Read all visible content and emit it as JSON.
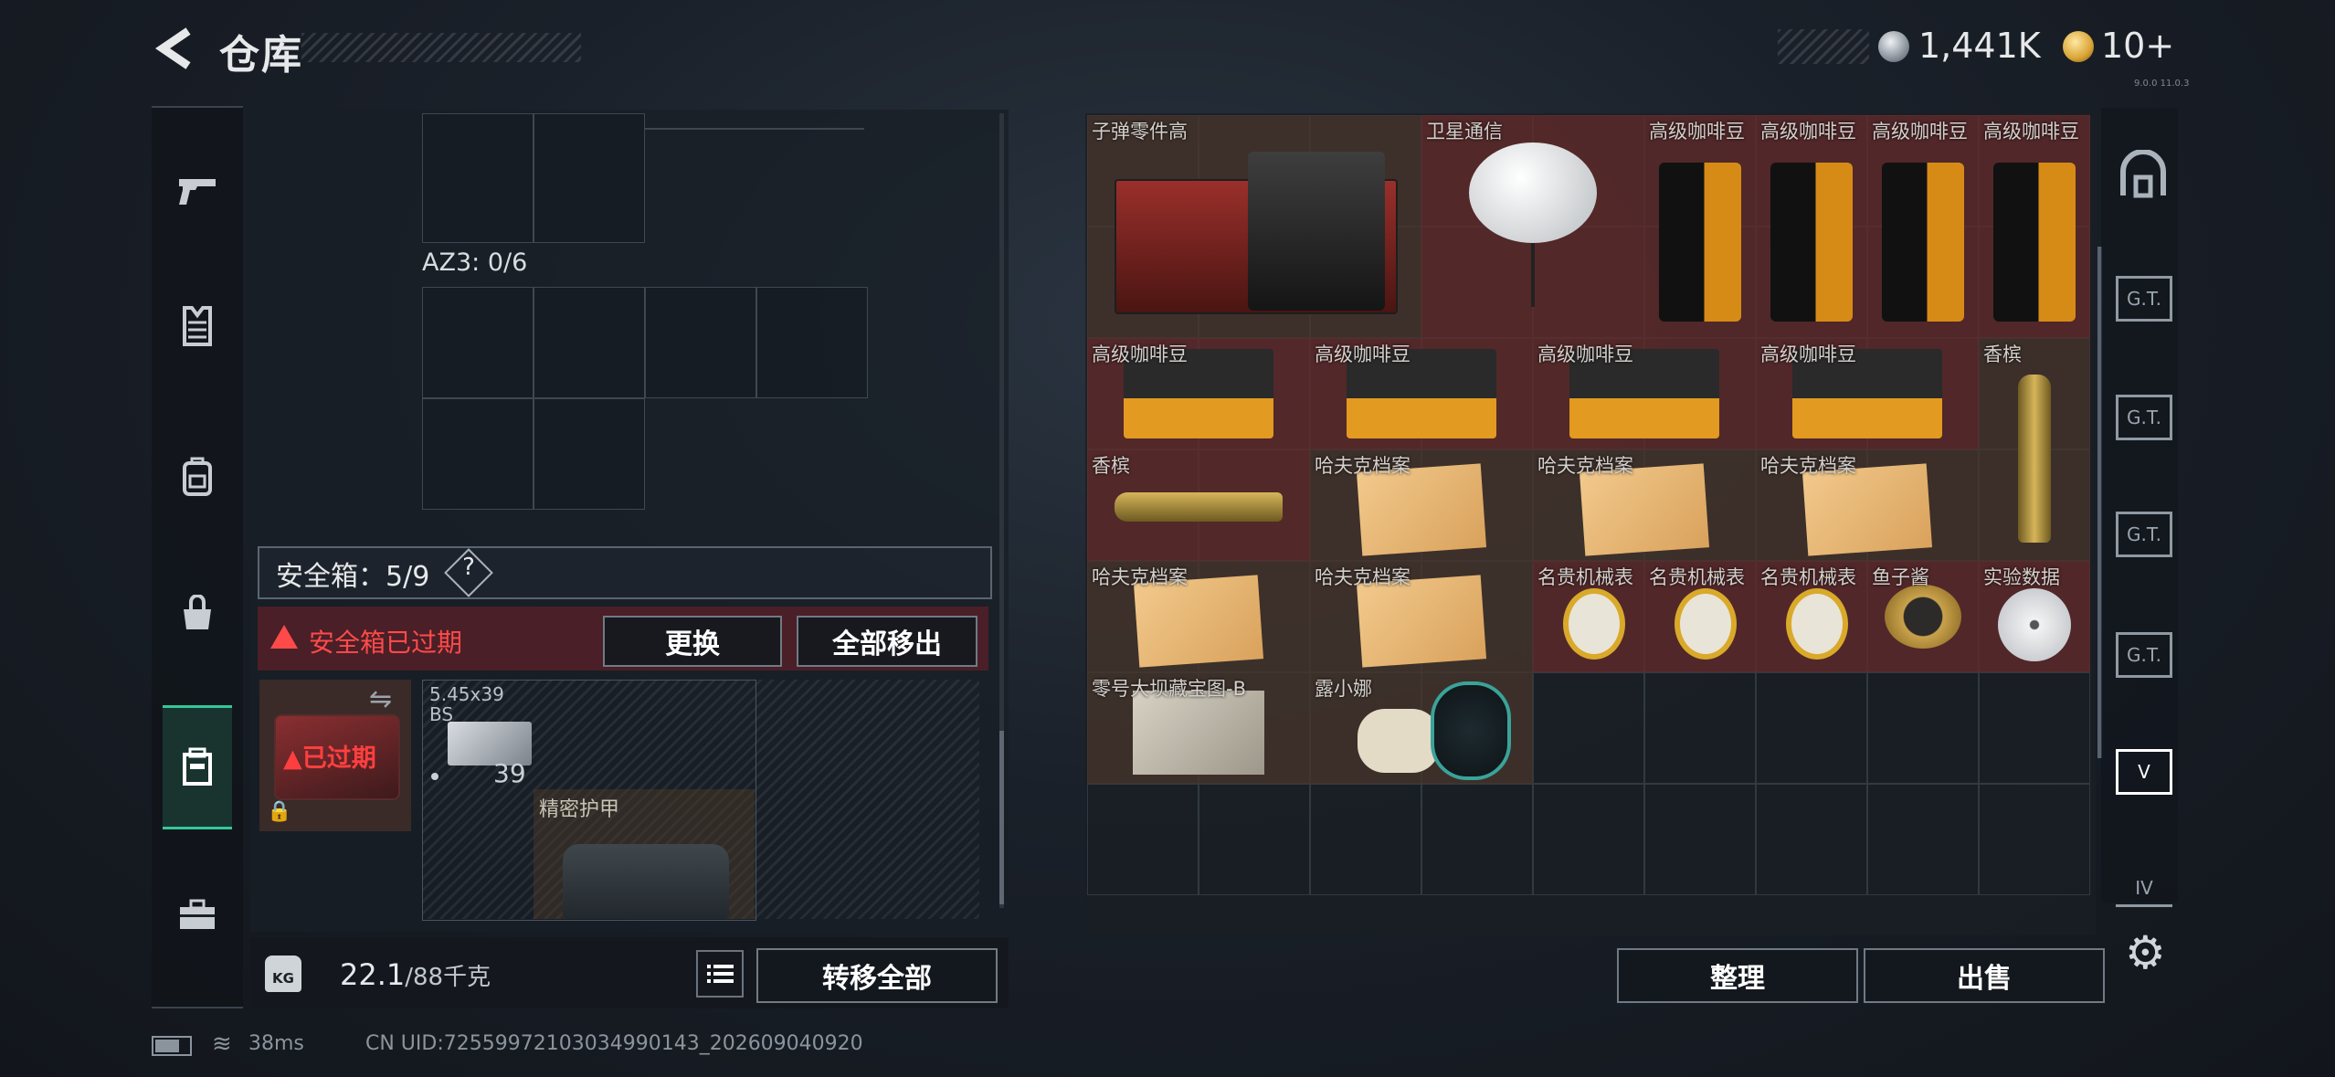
{
  "header": {
    "title": "仓库",
    "currency1": "1,441K",
    "currency2": "10+",
    "tiny_text": "9.0.0 11.0.3"
  },
  "left_panel": {
    "container_label": "AZ3: 0/6",
    "safe_box_label": "安全箱：5/9",
    "help_symbol": "?",
    "expired_warning": "安全箱已过期",
    "replace_button": "更换",
    "remove_all_button": "全部移出",
    "case_status": "已过期",
    "ammo_name_line1": "5.45x39",
    "ammo_name_line2": "BS",
    "ammo_count": "39",
    "armor_name": "精密护甲"
  },
  "weight": {
    "current": "22.1",
    "max": "/88千克",
    "kg_label": "KG"
  },
  "bottom": {
    "transfer_all": "转移全部",
    "sort": "整理",
    "sell": "出售"
  },
  "grid": {
    "items": [
      {
        "label": "子弹零件高",
        "icon": "ammo-parts-crate"
      },
      {
        "label": "卫星通信",
        "icon": "satellite-dish"
      },
      {
        "label": "高级咖啡豆",
        "icon": "coffee-bag"
      },
      {
        "label": "高级咖啡豆",
        "icon": "coffee-bag"
      },
      {
        "label": "高级咖啡豆",
        "icon": "coffee-bag"
      },
      {
        "label": "高级咖啡豆",
        "icon": "coffee-bag"
      },
      {
        "label": "高级咖啡豆",
        "icon": "coffee-box"
      },
      {
        "label": "高级咖啡豆",
        "icon": "coffee-box"
      },
      {
        "label": "高级咖啡豆",
        "icon": "coffee-box"
      },
      {
        "label": "高级咖啡豆",
        "icon": "coffee-box"
      },
      {
        "label": "香槟",
        "icon": "champagne-bottle-upright"
      },
      {
        "label": "香槟",
        "icon": "champagne-bottle-lying"
      },
      {
        "label": "哈夫克档案",
        "icon": "haf-file"
      },
      {
        "label": "哈夫克档案",
        "icon": "haf-file"
      },
      {
        "label": "哈夫克档案",
        "icon": "haf-file"
      },
      {
        "label": "哈夫克档案",
        "icon": "haf-file"
      },
      {
        "label": "哈夫克档案",
        "icon": "haf-file"
      },
      {
        "label": "名贵机械表",
        "icon": "gold-watch"
      },
      {
        "label": "名贵机械表",
        "icon": "gold-watch"
      },
      {
        "label": "名贵机械表",
        "icon": "gold-watch"
      },
      {
        "label": "鱼子酱",
        "icon": "caviar-tin"
      },
      {
        "label": "实验数据",
        "icon": "data-disc"
      },
      {
        "label": "零号大坝藏宝图-B",
        "icon": "treasure-map"
      },
      {
        "label": "露小娜",
        "icon": "plush-doll"
      }
    ]
  },
  "status_bar": {
    "ping": "38ms",
    "uid": "CN UID:7255997210303499014​3_202609040920"
  },
  "icons": {
    "back": "back-arrow-icon",
    "left_nav": [
      "gun-icon",
      "vest-icon",
      "backpack-icon",
      "bag-icon",
      "safe-box-icon",
      "toolbox-icon"
    ],
    "right_nav": [
      "bunker-icon",
      "storage-2-icon",
      "storage-3-icon",
      "storage-4-icon",
      "storage-5-icon",
      "storage-6-icon",
      "storage-7-icon"
    ]
  },
  "colors": {
    "accent_green": "#34c79a",
    "warning_red": "#ff4a4a",
    "item_red": "#622a2a",
    "item_brown": "#46342c"
  }
}
